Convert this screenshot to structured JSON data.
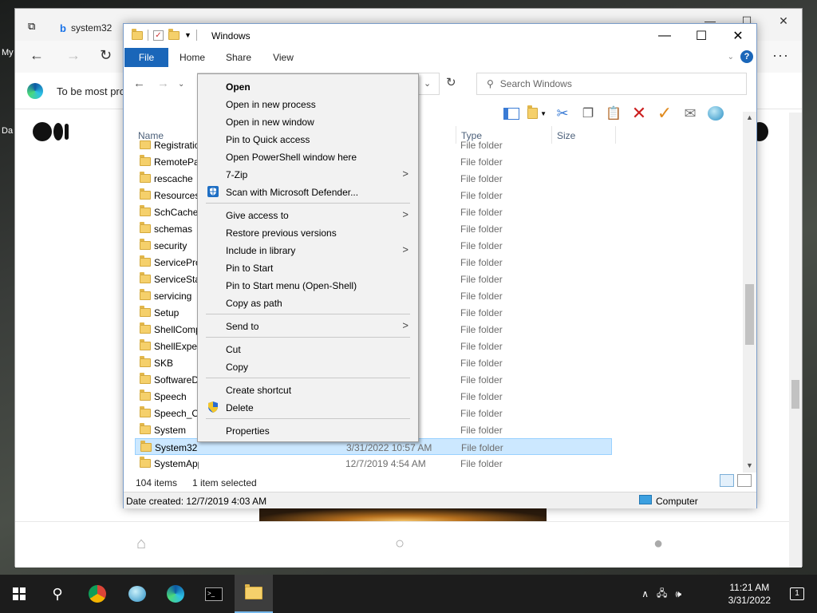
{
  "desktop": {
    "label_my": "My",
    "label_da": "Da"
  },
  "browser": {
    "tab_title": "system32",
    "notice_text": "To be most pro",
    "window_controls": [
      "—",
      "☐",
      "✕"
    ]
  },
  "explorer": {
    "title": "Windows",
    "ribbon_tabs": [
      "File",
      "Home",
      "Share",
      "View"
    ],
    "search_placeholder": "Search Windows",
    "columns": {
      "name": "Name",
      "type": "Type",
      "size": "Size"
    },
    "rows": [
      {
        "name": "Registration",
        "date": "M",
        "type": "File folder"
      },
      {
        "name": "RemotePackages",
        "date": "M",
        "type": "File folder"
      },
      {
        "name": "rescache",
        "date": "M",
        "type": "File folder"
      },
      {
        "name": "Resources",
        "date": "M",
        "type": "File folder"
      },
      {
        "name": "SchCache",
        "date": "M",
        "type": "File folder"
      },
      {
        "name": "schemas",
        "date": "M",
        "type": "File folder"
      },
      {
        "name": "security",
        "date": "M",
        "type": "File folder"
      },
      {
        "name": "ServiceProfiles",
        "date": "M",
        "type": "File folder"
      },
      {
        "name": "ServiceState",
        "date": "M",
        "type": "File folder"
      },
      {
        "name": "servicing",
        "date": "M",
        "type": "File folder"
      },
      {
        "name": "Setup",
        "date": "M",
        "type": "File folder"
      },
      {
        "name": "ShellComponents",
        "date": "M",
        "type": "File folder"
      },
      {
        "name": "ShellExperiences",
        "date": "M",
        "type": "File folder"
      },
      {
        "name": "SKB",
        "date": "M",
        "type": "File folder"
      },
      {
        "name": "SoftwareDistribution",
        "date": "M",
        "type": "File folder"
      },
      {
        "name": "Speech",
        "date": "M",
        "type": "File folder"
      },
      {
        "name": "Speech_OneCore",
        "date": "M",
        "type": "File folder"
      },
      {
        "name": "System",
        "date": "M",
        "type": "File folder"
      },
      {
        "name": "System32",
        "date": "3/31/2022 10:57 AM",
        "type": "File folder"
      },
      {
        "name": "SystemApps",
        "date": "12/7/2019 4:54 AM",
        "type": "File folder"
      }
    ],
    "status_items": "104 items",
    "status_selected": "1 item selected",
    "details_date": "Date created: 12/7/2019 4:03 AM",
    "details_location": "Computer"
  },
  "context_menu": {
    "items": [
      {
        "label": "Open",
        "bold": true
      },
      {
        "label": "Open in new process"
      },
      {
        "label": "Open in new window"
      },
      {
        "label": "Pin to Quick access"
      },
      {
        "label": "Open PowerShell window here"
      },
      {
        "label": "7-Zip",
        "submenu": true
      },
      {
        "label": "Scan with Microsoft Defender...",
        "icon": "defender-icon"
      },
      {
        "label": "Give access to",
        "submenu": true
      },
      {
        "label": "Restore previous versions"
      },
      {
        "label": "Include in library",
        "submenu": true
      },
      {
        "label": "Pin to Start"
      },
      {
        "label": "Pin to Start menu (Open-Shell)"
      },
      {
        "label": "Copy as path"
      },
      {
        "label": "Send to",
        "submenu": true
      },
      {
        "label": "Cut"
      },
      {
        "label": "Copy"
      },
      {
        "label": "Create shortcut"
      },
      {
        "label": "Delete",
        "icon": "shield-icon"
      },
      {
        "label": "Properties"
      }
    ]
  },
  "taskbar": {
    "time": "11:21 AM",
    "date": "3/31/2022",
    "notification_count": "1"
  },
  "colors": {
    "accent": "#1a66b9",
    "selection": "#cce8ff",
    "taskbar": "#1c1c1c"
  }
}
